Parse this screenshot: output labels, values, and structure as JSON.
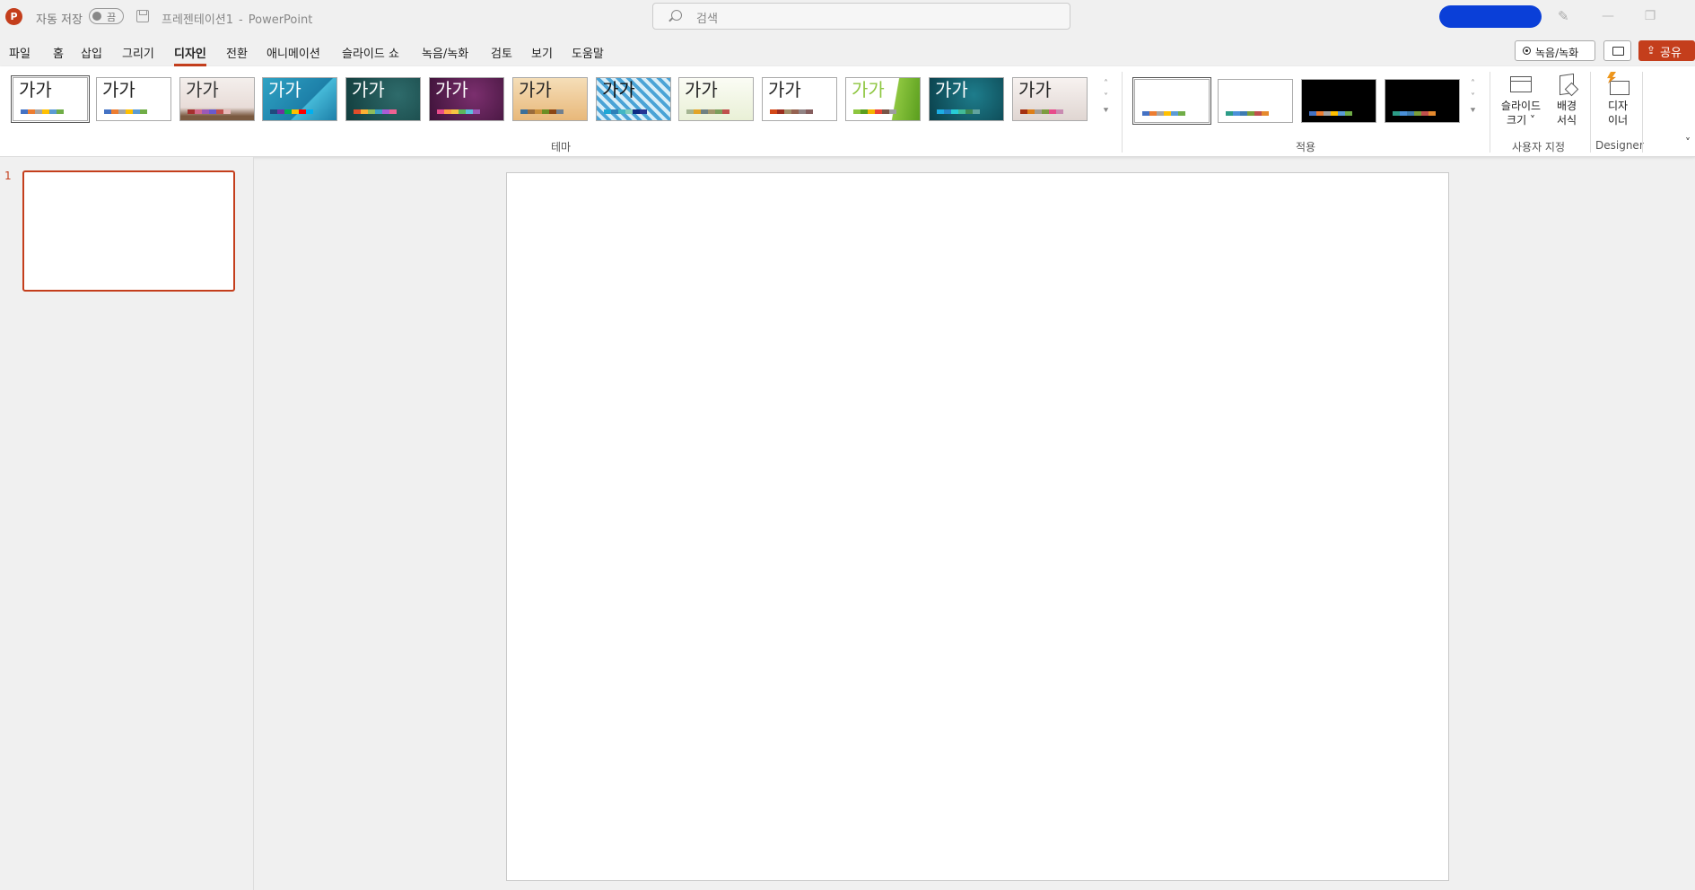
{
  "titlebar": {
    "app_logo": "P",
    "autosave_label": "자동 저장",
    "autosave_state": "끔",
    "doc_name": "프레젠테이션1",
    "separator": "-",
    "app_name": "PowerPoint",
    "search_placeholder": "검색",
    "pen_icon": "✎",
    "minimize": "—",
    "restore": "❐"
  },
  "menu": {
    "tabs": [
      "파일",
      "홈",
      "삽입",
      "그리기",
      "디자인",
      "전환",
      "애니메이션",
      "슬라이드 쇼",
      "녹음/녹화",
      "검토",
      "보기",
      "도움말"
    ],
    "active_tab": "디자인",
    "record_label": "녹음/녹화",
    "share_label": "공유",
    "share_icon": "⇪"
  },
  "ribbon": {
    "theme_sample_text": "가가",
    "themes_group_label": "테마",
    "variants_group_label": "적용",
    "customize_group_label": "사용자 지정",
    "designer_group_label": "Designer",
    "slide_size_line1": "슬라이드",
    "slide_size_line2": "크기 ˅",
    "format_bg_line1": "배경",
    "format_bg_line2": "서식",
    "designer_line1": "디자",
    "designer_line2": "이너",
    "scroll_up": "˄",
    "scroll_down": "˅",
    "scroll_more": "⯆",
    "collapse": "˅"
  },
  "themes": [
    {
      "bg": "#ffffff",
      "fg": "#222222",
      "colors": [
        "#4472c4",
        "#ed7d31",
        "#a5a5a5",
        "#ffc000",
        "#5b9bd5",
        "#70ad47"
      ]
    },
    {
      "bg": "#ffffff",
      "fg": "#222222",
      "colors": [
        "#4472c4",
        "#ed7d31",
        "#a5a5a5",
        "#ffc000",
        "#5b9bd5",
        "#70ad47"
      ]
    },
    {
      "bg": "linear-gradient(180deg,#f4efec 0%,#e8dcd8 70%,#7a5a40 90%)",
      "fg": "#333333",
      "colors": [
        "#a5302e",
        "#d26a8a",
        "#9b59b6",
        "#6a5acd",
        "#c0504d",
        "#e6b9b8"
      ]
    },
    {
      "bg": "linear-gradient(135deg,#2fa3c4 0%,#1d7fa8 60%,#45b9d8 61%,#1d7fa8 100%)",
      "fg": "#ffffff",
      "colors": [
        "#1f497d",
        "#7030a0",
        "#00b050",
        "#ffc000",
        "#ff0000",
        "#00b0f0"
      ]
    },
    {
      "bg": "radial-gradient(circle at 70% 40%,#2e6b6b,#123d3d)",
      "fg": "#ffffff",
      "colors": [
        "#e14d2a",
        "#fbb034",
        "#8fbc5a",
        "#3b9fc4",
        "#a95cd6",
        "#f06292"
      ]
    },
    {
      "bg": "radial-gradient(circle at 60% 40%,#7b2f6e,#3d1238)",
      "fg": "#ffffff",
      "colors": [
        "#e84c8b",
        "#ff9f43",
        "#f6c343",
        "#5cb85c",
        "#5bc0de",
        "#9b59b6"
      ]
    },
    {
      "bg": "linear-gradient(180deg,#f5deb8,#e8b87a)",
      "fg": "#222222",
      "colors": [
        "#3b6f9a",
        "#9a6b3b",
        "#c98f3a",
        "#6b8e23",
        "#8b4513",
        "#708090"
      ]
    },
    {
      "bg": "repeating-linear-gradient(45deg,#4aa3d6 0 4px,#d9eef8 4px 8px)",
      "fg": "#111111",
      "colors": [
        "#1ea7d6",
        "#2c7fb8",
        "#41b6c4",
        "#7fcdbb",
        "#0c2c84",
        "#253494"
      ]
    },
    {
      "bg": "linear-gradient(180deg,#fbfcf5,#e9f0d6)",
      "fg": "#222222",
      "colors": [
        "#a5b592",
        "#e2a528",
        "#6f8183",
        "#a3956b",
        "#7b9e5a",
        "#c0504d"
      ]
    },
    {
      "bg": "#ffffff",
      "fg": "#222222",
      "colors": [
        "#d34817",
        "#9b2d1f",
        "#a28e6a",
        "#956251",
        "#918485",
        "#855d5d"
      ]
    },
    {
      "bg": "linear-gradient(100deg,#ffffff 0 65%,#8dc63f 66%,#5a9e1e 100%)",
      "fg": "#8dc63f",
      "colors": [
        "#8dc63f",
        "#5a9e1e",
        "#f4b400",
        "#ea4335",
        "#795548",
        "#9e9e9e"
      ]
    },
    {
      "bg": "radial-gradient(circle at 60% 40%,#1e7d8c,#0a3f4a)",
      "fg": "#ffffff",
      "colors": [
        "#1cade4",
        "#2683c6",
        "#27ced7",
        "#42ba97",
        "#3e8853",
        "#62a39f"
      ]
    },
    {
      "bg": "linear-gradient(180deg,#f7f2f0,#e0d6d2)",
      "fg": "#222222",
      "colors": [
        "#a53010",
        "#de7e18",
        "#a29b94",
        "#7e9c40",
        "#e84c8b",
        "#c98bb1"
      ]
    }
  ],
  "variants": [
    {
      "bg": "#ffffff",
      "colors": [
        "#4472c4",
        "#ed7d31",
        "#a5a5a5",
        "#ffc000",
        "#5b9bd5",
        "#70ad47"
      ]
    },
    {
      "bg": "#ffffff",
      "colors": [
        "#2c9c87",
        "#4a90d9",
        "#3e7cb1",
        "#7a9e3a",
        "#c0504d",
        "#e68a2e"
      ]
    },
    {
      "bg": "#000000",
      "colors": [
        "#4472c4",
        "#ed7d31",
        "#a5a5a5",
        "#ffc000",
        "#5b9bd5",
        "#70ad47"
      ]
    },
    {
      "bg": "#000000",
      "colors": [
        "#2c9c87",
        "#4a90d9",
        "#3e7cb1",
        "#7a9e3a",
        "#c0504d",
        "#e68a2e"
      ]
    }
  ],
  "slides": {
    "items": [
      {
        "number": "1"
      }
    ]
  }
}
